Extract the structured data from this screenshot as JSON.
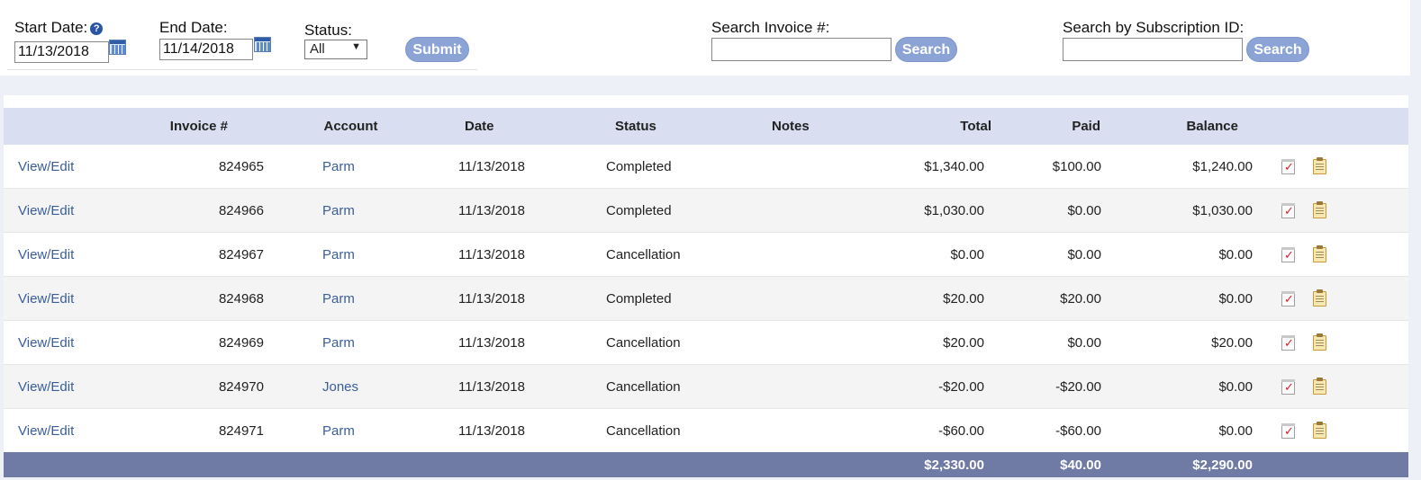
{
  "filters": {
    "start_date_label": "Start Date:",
    "start_date_value": "11/13/2018",
    "end_date_label": "End Date:",
    "end_date_value": "11/14/2018",
    "status_label": "Status:",
    "status_value": "All",
    "submit_label": "Submit",
    "search_invoice_label": "Search Invoice #:",
    "search_invoice_value": "",
    "search_invoice_button": "Search",
    "search_subscription_label": "Search by Subscription ID:",
    "search_subscription_value": "",
    "search_subscription_button": "Search",
    "help_icon": "question-circle-icon",
    "calendar_icon": "calendar-icon"
  },
  "table": {
    "columns": [
      "",
      "Invoice #",
      "Account",
      "Date",
      "Status",
      "Notes",
      "Total",
      "Paid",
      "Balance",
      ""
    ],
    "rows": [
      {
        "action": "View/Edit",
        "invoice": "824965",
        "account": "Parm",
        "date": "11/13/2018",
        "status": "Completed",
        "notes": "",
        "total": "$1,340.00",
        "paid": "$100.00",
        "balance": "$1,240.00"
      },
      {
        "action": "View/Edit",
        "invoice": "824966",
        "account": "Parm",
        "date": "11/13/2018",
        "status": "Completed",
        "notes": "",
        "total": "$1,030.00",
        "paid": "$0.00",
        "balance": "$1,030.00"
      },
      {
        "action": "View/Edit",
        "invoice": "824967",
        "account": "Parm",
        "date": "11/13/2018",
        "status": "Cancellation",
        "notes": "",
        "total": "$0.00",
        "paid": "$0.00",
        "balance": "$0.00"
      },
      {
        "action": "View/Edit",
        "invoice": "824968",
        "account": "Parm",
        "date": "11/13/2018",
        "status": "Completed",
        "notes": "",
        "total": "$20.00",
        "paid": "$20.00",
        "balance": "$0.00"
      },
      {
        "action": "View/Edit",
        "invoice": "824969",
        "account": "Parm",
        "date": "11/13/2018",
        "status": "Cancellation",
        "notes": "",
        "total": "$20.00",
        "paid": "$0.00",
        "balance": "$20.00"
      },
      {
        "action": "View/Edit",
        "invoice": "824970",
        "account": "Jones",
        "date": "11/13/2018",
        "status": "Cancellation",
        "notes": "",
        "total": "-$20.00",
        "paid": "-$20.00",
        "balance": "$0.00"
      },
      {
        "action": "View/Edit",
        "invoice": "824971",
        "account": "Parm",
        "date": "11/13/2018",
        "status": "Cancellation",
        "notes": "",
        "total": "-$60.00",
        "paid": "-$60.00",
        "balance": "$0.00"
      }
    ],
    "row_icons": [
      "checklist-icon",
      "clipboard-icon"
    ],
    "footer": {
      "total": "$2,330.00",
      "paid": "$40.00",
      "balance": "$2,290.00"
    }
  },
  "colors": {
    "header_bg": "#d9def0",
    "footer_bg": "#6f7aa5",
    "button_bg": "#8ca3d6",
    "link": "#3a5e9a"
  }
}
